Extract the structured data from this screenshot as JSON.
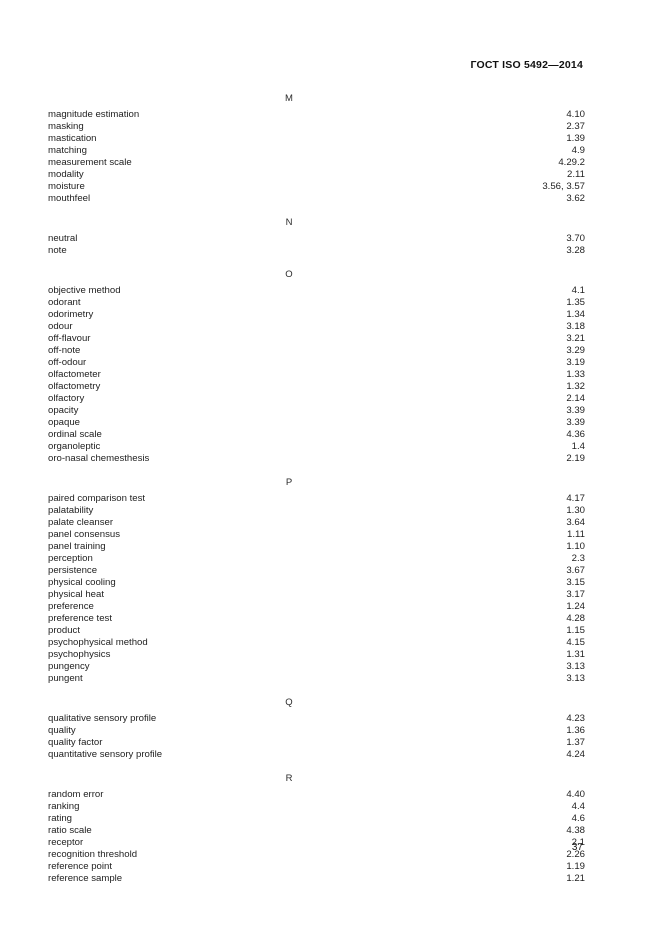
{
  "header": {
    "standard_title": "ГОСТ ISO 5492—2014"
  },
  "footer": {
    "page_number": "37"
  },
  "index": {
    "groups": [
      {
        "letter": "M",
        "entries": [
          {
            "term": "magnitude estimation",
            "ref": "4.10"
          },
          {
            "term": "masking",
            "ref": "2.37"
          },
          {
            "term": "mastication",
            "ref": "1.39"
          },
          {
            "term": "matching",
            "ref": "4.9"
          },
          {
            "term": "measurement scale",
            "ref": "4.29.2"
          },
          {
            "term": "modality",
            "ref": "2.11"
          },
          {
            "term": "moisture",
            "ref": "3.56, 3.57"
          },
          {
            "term": "mouthfeel",
            "ref": "3.62"
          }
        ]
      },
      {
        "letter": "N",
        "entries": [
          {
            "term": "neutral",
            "ref": "3.70"
          },
          {
            "term": "note",
            "ref": "3.28"
          }
        ]
      },
      {
        "letter": "O",
        "entries": [
          {
            "term": "objective method",
            "ref": "4.1"
          },
          {
            "term": "odorant",
            "ref": "1.35"
          },
          {
            "term": "odorimetry",
            "ref": "1.34"
          },
          {
            "term": "odour",
            "ref": "3.18"
          },
          {
            "term": "off-flavour",
            "ref": "3.21"
          },
          {
            "term": "off-note",
            "ref": "3.29"
          },
          {
            "term": "off-odour",
            "ref": "3.19"
          },
          {
            "term": "olfactometer",
            "ref": "1.33"
          },
          {
            "term": "olfactometry",
            "ref": "1.32"
          },
          {
            "term": "olfactory",
            "ref": "2.14"
          },
          {
            "term": "opacity",
            "ref": "3.39"
          },
          {
            "term": "opaque",
            "ref": "3.39"
          },
          {
            "term": "ordinal scale",
            "ref": "4.36"
          },
          {
            "term": "organoleptic",
            "ref": "1.4"
          },
          {
            "term": "oro-nasal chemesthesis",
            "ref": "2.19"
          }
        ]
      },
      {
        "letter": "P",
        "entries": [
          {
            "term": "paired comparison test",
            "ref": "4.17"
          },
          {
            "term": "palatability",
            "ref": "1.30"
          },
          {
            "term": "palate cleanser",
            "ref": "3.64"
          },
          {
            "term": "panel consensus",
            "ref": "1.11"
          },
          {
            "term": "panel training",
            "ref": "1.10"
          },
          {
            "term": "perception",
            "ref": "2.3"
          },
          {
            "term": "persistence",
            "ref": "3.67"
          },
          {
            "term": "physical cooling",
            "ref": "3.15"
          },
          {
            "term": "physical heat",
            "ref": "3.17"
          },
          {
            "term": "preference",
            "ref": "1.24"
          },
          {
            "term": "preference test",
            "ref": "4.28"
          },
          {
            "term": "product",
            "ref": "1.15"
          },
          {
            "term": "psychophysical method",
            "ref": "4.15"
          },
          {
            "term": "psychophysics",
            "ref": "1.31"
          },
          {
            "term": "pungency",
            "ref": "3.13"
          },
          {
            "term": "pungent",
            "ref": "3.13"
          }
        ]
      },
      {
        "letter": "Q",
        "entries": [
          {
            "term": "qualitative sensory profile",
            "ref": "4.23"
          },
          {
            "term": "quality",
            "ref": "1.36"
          },
          {
            "term": "quality factor",
            "ref": "1.37"
          },
          {
            "term": "quantitative sensory profile",
            "ref": "4.24"
          }
        ]
      },
      {
        "letter": "R",
        "entries": [
          {
            "term": "random error",
            "ref": "4.40"
          },
          {
            "term": "ranking",
            "ref": "4.4"
          },
          {
            "term": "rating",
            "ref": "4.6"
          },
          {
            "term": "ratio scale",
            "ref": "4.38"
          },
          {
            "term": "receptor",
            "ref": "2.1"
          },
          {
            "term": "recognition threshold",
            "ref": "2.26"
          },
          {
            "term": "reference point",
            "ref": "1.19"
          },
          {
            "term": "reference sample",
            "ref": "1.21"
          }
        ]
      }
    ]
  }
}
